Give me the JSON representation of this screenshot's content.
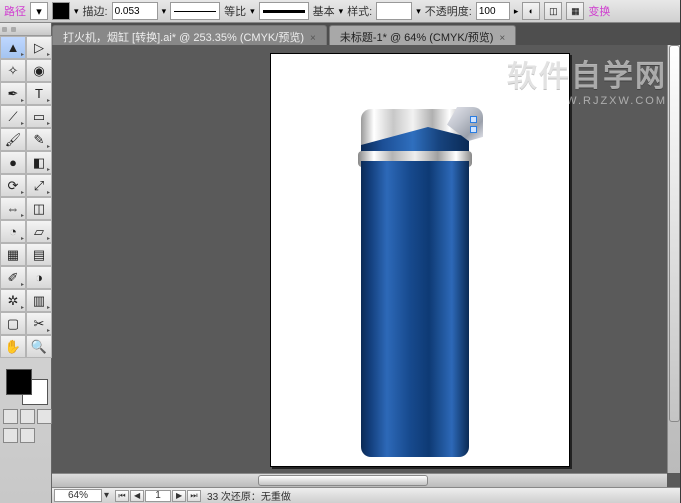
{
  "controlbar": {
    "path_label": "路径",
    "stroke_label": "描边:",
    "stroke_value": "0.053",
    "unit_label": "等比",
    "basic_label": "基本",
    "style_label": "样式:",
    "opacity_label": "不透明度:",
    "opacity_value": "100",
    "transform_label": "变换"
  },
  "tabs": [
    {
      "title": "打火机，烟缸 [转换].ai* @ 253.35% (CMYK/预览)"
    },
    {
      "title": "未标题-1* @ 64% (CMYK/预览)"
    }
  ],
  "status": {
    "zoom": "64%",
    "page": "1",
    "history": "33 次还原：无重做"
  },
  "watermark": {
    "line1": "软件自学网",
    "line2": "WWW.RJZXW.COM"
  },
  "tools": {
    "row1": [
      "sel",
      "direct"
    ],
    "row2": [
      "wand",
      "lasso"
    ],
    "row3": [
      "pen",
      "type"
    ],
    "row4": [
      "line",
      "rect"
    ],
    "row5": [
      "brush",
      "pencil"
    ],
    "row6": [
      "blob",
      "eraser"
    ],
    "row7": [
      "rotate",
      "scale"
    ],
    "row8": [
      "width",
      "free"
    ],
    "row9": [
      "shape",
      "warp"
    ],
    "row10": [
      "mesh",
      "gradient"
    ],
    "row11": [
      "eyedrop",
      "blend"
    ],
    "row12": [
      "spray",
      "graph"
    ],
    "row13": [
      "artboard",
      "slice"
    ],
    "row14": [
      "persp",
      "grid"
    ],
    "row15": [
      "hand",
      "zoom"
    ]
  },
  "icons": {
    "dropdown": "▾",
    "nav_first": "⏮",
    "nav_prev": "◀",
    "nav_next": "▶",
    "nav_last": "⏭"
  }
}
